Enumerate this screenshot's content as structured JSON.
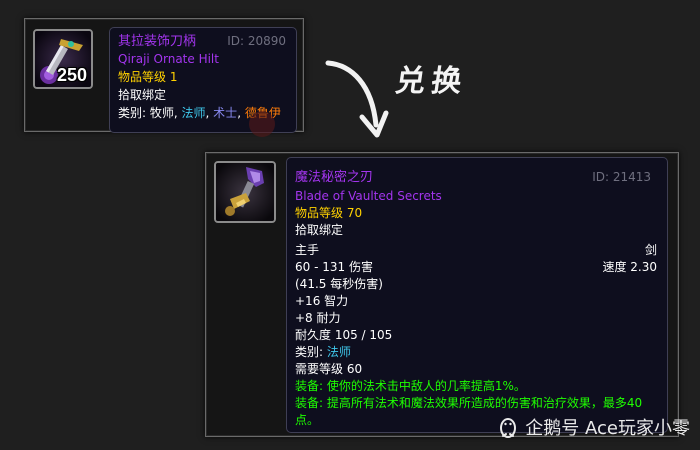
{
  "item1": {
    "stack_count": "250",
    "name_cn": "其拉装饰刀柄",
    "name_en": "Qiraji Ornate Hilt",
    "id_text": "ID: 20890",
    "item_level": "物品等级 1",
    "bind": "拾取绑定",
    "classes_label": "类别: ",
    "classes": [
      "牧师",
      "法师",
      "术士",
      "德鲁伊"
    ],
    "separator": ", "
  },
  "transition": {
    "label": "兑换"
  },
  "item2": {
    "name_cn": "魔法秘密之刃",
    "name_en": "Blade of Vaulted Secrets",
    "id_text": "ID: 21413",
    "item_level": "物品等级 70",
    "bind": "拾取绑定",
    "slot": "主手",
    "weapon_type": "剑",
    "damage": "60 - 131 伤害",
    "speed": "速度 2.30",
    "dps": "(41.5 每秒伤害)",
    "stat_int": "+16 智力",
    "stat_sta": "+8 耐力",
    "durability": "耐久度 105 / 105",
    "classes_label": "类别: ",
    "class": "法师",
    "required_level": "需要等级 60",
    "equip1": "装备: 使你的法术击中敌人的几率提高1%。",
    "equip2_line1": "装备: 提高所有法术和魔法效果所造成的伤害和治疗效果，最多40",
    "equip2_line2": "点。"
  },
  "footer": {
    "text": "企鹅号 Ace玩家小零"
  },
  "colors": {
    "epic": "#a335ee",
    "item_level": "#ffd100",
    "equip": "#1eff00",
    "mage": "#3fc7eb",
    "warlock": "#8788ee",
    "druid": "#ff7c0a"
  }
}
